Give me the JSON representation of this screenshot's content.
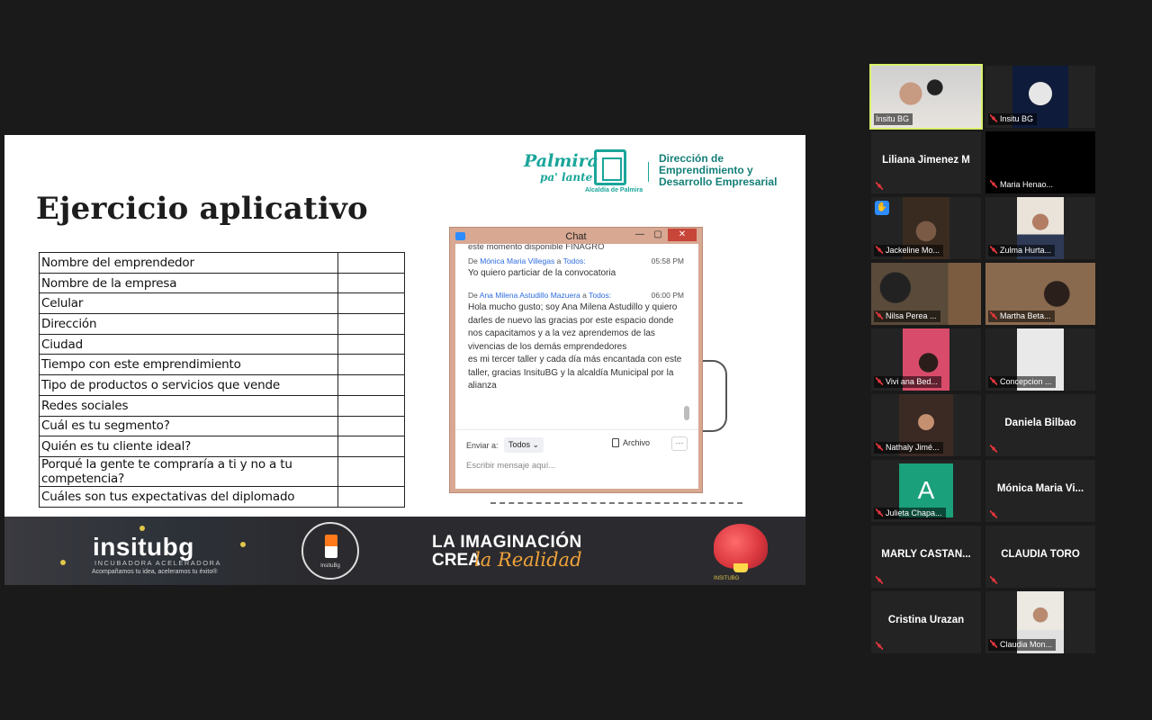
{
  "slide": {
    "title": "Ejercicio aplicativo",
    "logo": {
      "palmira": "Palmira",
      "palmira_sub": "pa' lante",
      "alcaldia": "Alcaldía de Palmira",
      "direccion": [
        "Dirección de",
        "Emprendimiento y",
        "Desarrollo Empresarial"
      ]
    },
    "form_rows": [
      "Nombre del emprendedor",
      "Nombre de la empresa",
      "Celular",
      "Dirección",
      "Ciudad",
      "Tiempo con este emprendimiento",
      "Tipo de productos o servicios que vende",
      "Redes sociales",
      "Cuál es tu segmento?",
      "Quién es tu cliente ideal?",
      "Porqué la gente te compraría a ti y no a tu competencia?",
      "Cuáles son tus expectativas del diplomado"
    ],
    "banner": {
      "insitu_title": "insitubg",
      "insitu_sub": "INCUBADORA ACELERADORA",
      "insitu_tag": "Acompañamos tu idea, aceleramos tu éxito®",
      "circle_name": "InsituBg",
      "imag_line1": "LA IMAGINACIÓN",
      "imag_line2": "CREA",
      "imag_line3": "la Realidad",
      "brain_label": "INSITUBG"
    }
  },
  "chat": {
    "title": "Chat",
    "clipped_text": "este momento disponible FINAGRO",
    "messages": [
      {
        "from_prefix": "De",
        "from": "Mónica Maria Villegas",
        "to_prefix": "a",
        "to": "Todos:",
        "time": "05:58 PM",
        "text": "Yo quiero particiar  de la convocatoria"
      },
      {
        "from_prefix": "De",
        "from": "Ana Milena Astudillo Mazuera",
        "to_prefix": "a",
        "to": "Todos:",
        "time": "06:00 PM",
        "text": "Hola mucho gusto; soy Ana Milena Astudillo y quiero darles de nuevo las gracias por este espacio donde nos capacitamos y a la vez aprendemos de las vivencias de los demás emprendedores\nes mi tercer taller y cada día más encantada con este taller, gracias InsituBG y la alcaldía Municipal por la alianza"
      }
    ],
    "send_to_label": "Enviar a:",
    "send_to_value": "Todos",
    "file_label": "Archivo",
    "more_label": "···",
    "input_placeholder": "Escribir mensaje aquí..."
  },
  "participants": [
    {
      "name": "Insitu BG",
      "type": "video",
      "active": true,
      "muted": false
    },
    {
      "name": "Insitu BG",
      "type": "video",
      "muted": true
    },
    {
      "name": "Liliana Jimenez M",
      "type": "name",
      "muted": true
    },
    {
      "name": "Maria Henao...",
      "type": "video",
      "muted": true
    },
    {
      "name": "Jackeline Mo...",
      "type": "video",
      "muted": true,
      "hand_raised": true
    },
    {
      "name": "Zulma Hurta...",
      "type": "video",
      "muted": true
    },
    {
      "name": "Nilsa Perea ...",
      "type": "video",
      "muted": true
    },
    {
      "name": "Martha Beta...",
      "type": "video",
      "muted": true
    },
    {
      "name": "Vivi ana Bed...",
      "type": "video",
      "muted": true
    },
    {
      "name": "Concepcion ...",
      "type": "video",
      "muted": true
    },
    {
      "name": "Nathaly Jimé...",
      "type": "video",
      "muted": true
    },
    {
      "name": "Daniela Bilbao",
      "type": "name",
      "muted": true
    },
    {
      "name": "Julieta Chapa...",
      "type": "avatar",
      "avatar_letter": "A",
      "muted": true
    },
    {
      "name": "Mónica  Maria  Vi...",
      "type": "name",
      "muted": true
    },
    {
      "name": "MARLY CASTAÑ...",
      "type": "name",
      "muted": true
    },
    {
      "name": "CLAUDIA TORO",
      "type": "name",
      "muted": true
    },
    {
      "name": "Cristina Urazan",
      "type": "name",
      "muted": true
    },
    {
      "name": "Claudia Mon...",
      "type": "video",
      "muted": true
    }
  ],
  "colors": {
    "active_speaker": "#d8f26b",
    "muted_icon": "#e0353b",
    "accent_teal": "#1aa59a",
    "chat_frame": "#d8a892"
  }
}
